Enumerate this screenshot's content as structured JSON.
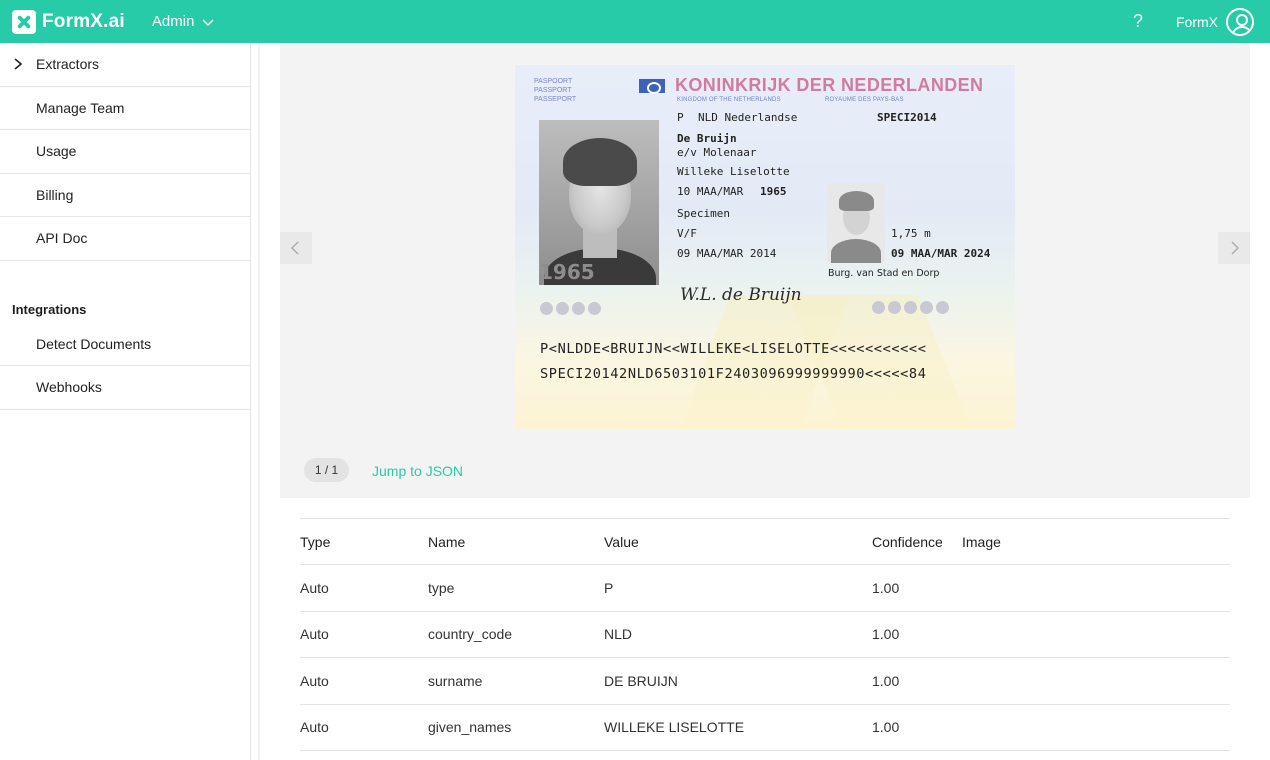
{
  "header": {
    "logo_text": "FormX.ai",
    "workspace": "Admin",
    "help_symbol": "?",
    "user_name": "FormX"
  },
  "sidebar": {
    "items": [
      {
        "label": "Extractors"
      },
      {
        "label": "Manage Team"
      },
      {
        "label": "Usage"
      },
      {
        "label": "Billing"
      },
      {
        "label": "API Doc"
      }
    ],
    "group_title": "Integrations",
    "group_items": [
      {
        "label": "Detect Documents"
      },
      {
        "label": "Webhooks"
      }
    ]
  },
  "viewer": {
    "pager": "1 / 1",
    "jump_link": "Jump to JSON",
    "passport": {
      "doc_type_labels": "PASPOORT\nPASSPORT\nPASSEPORT",
      "title": "KONINKRIJK DER NEDERLANDEN",
      "sub_en": "KINGDOM OF THE NETHERLANDS",
      "sub_fr": "ROYAUME DES PAYS-BAS",
      "type_code": "P",
      "nationality": "NLD Nederlandse",
      "doc_number": "SPECI2014",
      "surname": "De Bruijn",
      "spouse": "e/v Molenaar",
      "given_names": "Willeke Liselotte",
      "birth_date": "10 MAA/MAR",
      "birth_year": "1965",
      "birth_place": "Specimen",
      "sex": "V/F",
      "issue_date": "09 MAA/MAR 2014",
      "height": "1,75 m",
      "expiry_date": "09 MAA/MAR 2024",
      "authority": "Burg. van Stad en Dorp",
      "photo_year": "1965",
      "signature": "W.L. de Bruijn",
      "mrz1": "P<NLDDE<BRUIJN<<WILLEKE<LISELOTTE<<<<<<<<<<<",
      "mrz2": "SPECI20142NLD6503101F2403096999999990<<<<<84"
    }
  },
  "table": {
    "columns": [
      "Type",
      "Name",
      "Value",
      "Confidence",
      "Image"
    ],
    "rows": [
      {
        "type": "Auto",
        "name": "type",
        "value": "P",
        "confidence": "1.00"
      },
      {
        "type": "Auto",
        "name": "country_code",
        "value": "NLD",
        "confidence": "1.00"
      },
      {
        "type": "Auto",
        "name": "surname",
        "value": "DE BRUIJN",
        "confidence": "1.00"
      },
      {
        "type": "Auto",
        "name": "given_names",
        "value": "WILLEKE LISELOTTE",
        "confidence": "1.00"
      }
    ]
  },
  "colors": {
    "brand": "#27cba8",
    "link": "#27cba8"
  }
}
